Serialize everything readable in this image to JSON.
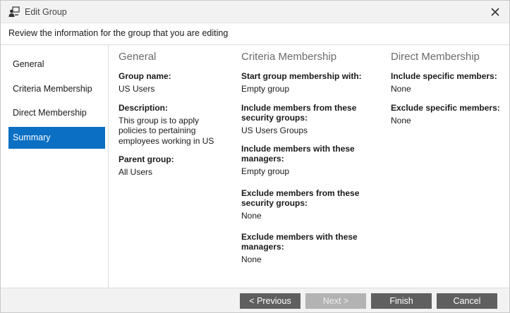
{
  "window": {
    "title": "Edit Group"
  },
  "subtitle": "Review the information for the group that you are editing",
  "sidebar": {
    "items": [
      {
        "label": "General"
      },
      {
        "label": "Criteria Membership"
      },
      {
        "label": "Direct Membership"
      },
      {
        "label": "Summary",
        "active": true
      }
    ]
  },
  "summary": {
    "general": {
      "heading": "General",
      "fields": [
        {
          "label": "Group name:",
          "value": "US Users"
        },
        {
          "label": "Description:",
          "value_lines": [
            "This group is to apply",
            "policies to pertaining",
            "employees working in US"
          ]
        },
        {
          "label": "Parent group:",
          "value": "All Users"
        }
      ]
    },
    "criteria": {
      "heading": "Criteria Membership",
      "fields": [
        {
          "label_lines": [
            "Start group membership with:"
          ],
          "value": "Empty group"
        },
        {
          "label_lines": [
            "Include members from these",
            "security groups:"
          ],
          "value": "US Users Groups"
        },
        {
          "label_lines": [
            "Include members with these",
            "managers:"
          ],
          "value": "Empty group"
        },
        {
          "label_lines": [
            "Exclude members from these",
            "security groups:"
          ],
          "value": "None"
        },
        {
          "label_lines": [
            "Exclude members with these",
            "managers:"
          ],
          "value": "None"
        }
      ]
    },
    "direct": {
      "heading": "Direct Membership",
      "fields": [
        {
          "label": "Include specific members:",
          "value": "None"
        },
        {
          "label": "Exclude specific members:",
          "value": "None"
        }
      ]
    }
  },
  "footer": {
    "previous_label": "< Previous",
    "next_label": "Next >",
    "finish_label": "Finish",
    "cancel_label": "Cancel"
  },
  "colors": {
    "accent": "#0b6fc4",
    "button": "#5f5f5f",
    "button_disabled": "#b3b3b3"
  },
  "icons": {
    "title": "group-edit-icon",
    "close": "close-icon"
  }
}
